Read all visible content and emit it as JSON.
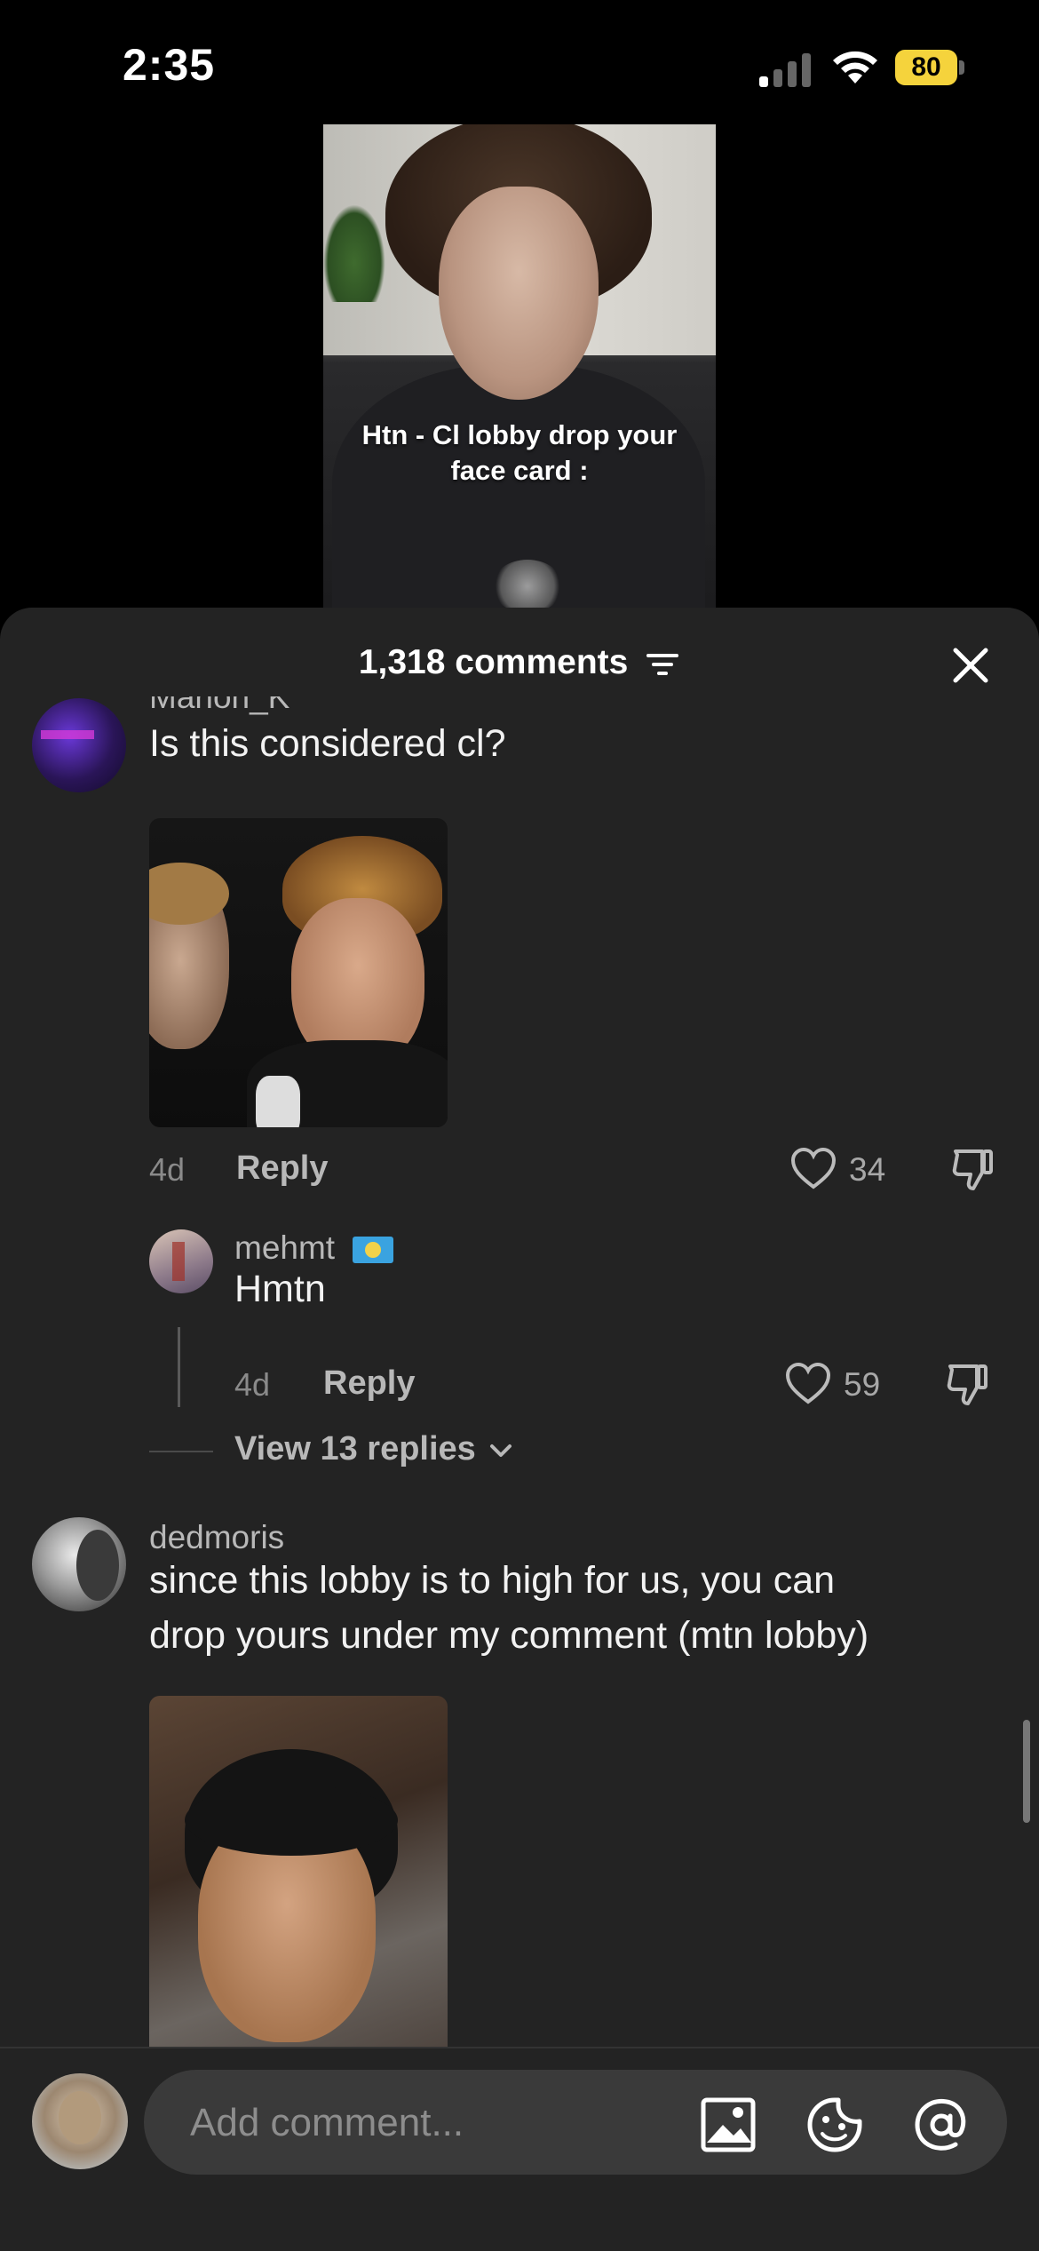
{
  "status_bar": {
    "time": "2:35",
    "battery": "80"
  },
  "video": {
    "caption_line1": "Htn - Cl lobby drop your",
    "caption_line2": "face card :"
  },
  "sheet": {
    "comments_count": "1,318 comments"
  },
  "comments": [
    {
      "username": "Marion_K",
      "text": "Is this considered cl?",
      "time": "4d",
      "reply_label": "Reply",
      "likes": "34"
    },
    {
      "username": "mehmt",
      "text": "Hmtn",
      "time": "4d",
      "reply_label": "Reply",
      "likes": "59"
    },
    {
      "username": "dedmoris",
      "text_line1": "since this lobby is to high for us, you can",
      "text_line2": "drop yours under my comment (mtn lobby)"
    }
  ],
  "view_replies": "View 13 replies",
  "composer": {
    "placeholder": "Add comment..."
  }
}
